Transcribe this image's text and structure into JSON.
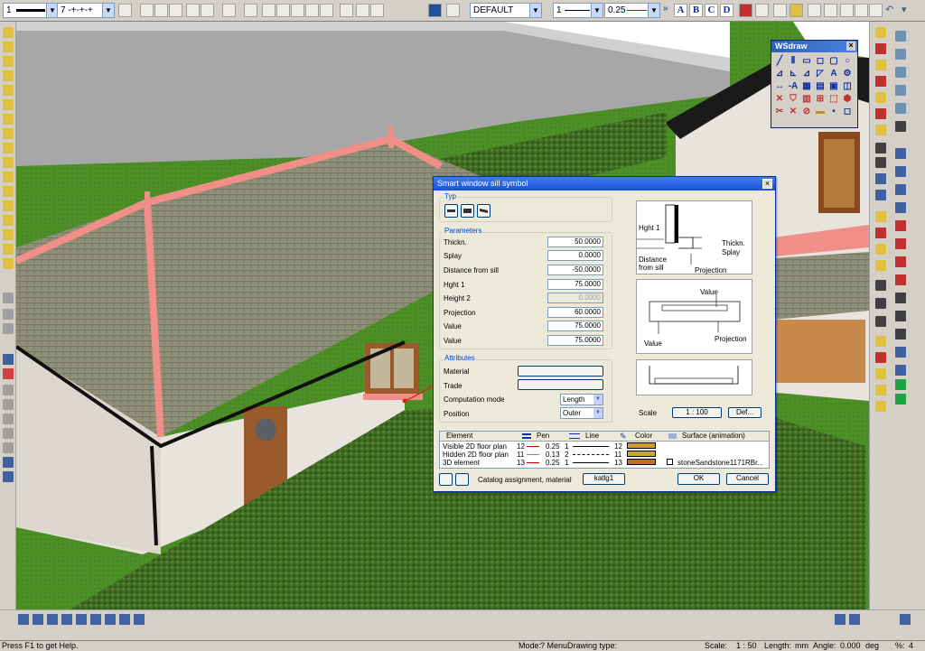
{
  "toolbar": {
    "pen_number": "1",
    "layer_combo": "7 -+-+-+",
    "style_combo": "DEFAULT",
    "line_combo": "1",
    "line_thickness": "0.25",
    "text_buttons": [
      "A",
      "B",
      "C",
      "D"
    ]
  },
  "wsdraw": {
    "title": "WSdraw",
    "close": "×",
    "tools": [
      "╱",
      "⦀",
      "▭",
      "◻",
      "▢",
      "○",
      "⊿",
      "⊾",
      "⊿",
      "◸",
      "A",
      "⚙",
      "↔",
      "-A",
      "▦",
      "▤",
      "▣",
      "◫",
      "✕",
      "⛉",
      "▥",
      "⊞",
      "⬚",
      "⬢",
      "✂",
      "✕",
      "⊘",
      "▬",
      "▪",
      "◻"
    ]
  },
  "dialog": {
    "title": "Smart window sill symbol",
    "close": "×",
    "typ": {
      "label": "Typ",
      "buttons": [
        "type-1",
        "type-2",
        "type-3"
      ]
    },
    "parameters": {
      "label": "Parameters",
      "rows": [
        {
          "label": "Thickn.",
          "value": "50.0000",
          "disabled": false
        },
        {
          "label": "Splay",
          "value": "0.0000",
          "disabled": false
        },
        {
          "label": "Distance from sill",
          "value": "-50.0000",
          "disabled": false
        },
        {
          "label": "Hght 1",
          "value": "75.0000",
          "disabled": false
        },
        {
          "label": "Height 2",
          "value": "0.0000",
          "disabled": true
        },
        {
          "label": "Projection",
          "value": "60.0000",
          "disabled": false
        },
        {
          "label": "Value",
          "value": "75.0000",
          "disabled": false
        },
        {
          "label": "Value",
          "value": "75.0000",
          "disabled": false
        }
      ]
    },
    "attributes": {
      "label": "Attributes",
      "material_label": "Material",
      "trade_label": "Trade",
      "computation_label": "Computation mode",
      "computation_value": "Length",
      "position_label": "Position",
      "position_value": "Outer"
    },
    "preview": {
      "hght1": "Hght 1",
      "thickn": "Thickn.",
      "splay": "Splay",
      "distance": "Distance",
      "from_sill": "from sill",
      "projection": "Projection",
      "value_top": "Value",
      "value_left": "Value",
      "projection2": "Projection"
    },
    "scale_label": "Scale",
    "scale_value": "1 : 100",
    "def_button": "Def...",
    "table": {
      "headers": {
        "element": "Element",
        "pen": "Pen",
        "line": "Line",
        "color": "Color",
        "surface": "Surface (animation)"
      },
      "rows": [
        {
          "element": "Visible 2D floor plan",
          "pen_no": "12",
          "pen_w": "0.25",
          "line_no": "1",
          "color_no": "12",
          "color": "#d39a2c",
          "surface": ""
        },
        {
          "element": "Hidden 2D floor plan",
          "pen_no": "11",
          "pen_w": "0.13",
          "line_no": "2",
          "color_no": "11",
          "color": "#c4a93a",
          "surface": ""
        },
        {
          "element": "3D element",
          "pen_no": "13",
          "pen_w": "0.25",
          "line_no": "1",
          "color_no": "13",
          "color": "#c46a2c",
          "surface": "stoneSandstone1171RBr..."
        }
      ]
    },
    "catalog_label": "Catalog assignment, material",
    "katlg_button": "katlg1",
    "ok_button": "OK",
    "cancel_button": "Cancel"
  },
  "status": {
    "help": "Press F1 to get Help.",
    "mode": "Mode:",
    "mode_value": "? Menu",
    "drawing_type": "Drawing type:",
    "scale_label": "Scale:",
    "scale_value": "1 : 50",
    "length_label": "Length:",
    "length_unit": "mm",
    "angle_label": "Angle:",
    "angle_value": "0.000",
    "angle_unit": "deg",
    "pct_label": "%:",
    "pct_value": "4"
  },
  "colors": {
    "roof": "#8f9078",
    "ridge": "#f08f87",
    "hedge": "#3f6b22",
    "grass": "#4c8f26",
    "road": "#a7a7a9",
    "wall": "#e8e3dc",
    "dialog_bg": "#ece9d8",
    "accent": "#0046d5"
  }
}
